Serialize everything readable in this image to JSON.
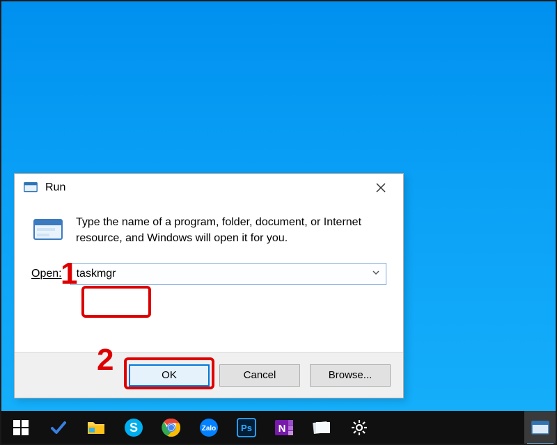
{
  "dialog": {
    "title": "Run",
    "instructions": "Type the name of a program, folder, document, or Internet resource, and Windows will open it for you.",
    "open_label": "Open:",
    "open_value": "taskmgr",
    "buttons": {
      "ok": "OK",
      "cancel": "Cancel",
      "browse": "Browse..."
    }
  },
  "annotations": {
    "label1": "1",
    "label2": "2"
  },
  "taskbar": {
    "start": "start-icon",
    "items": [
      "todo",
      "file-explorer",
      "skype",
      "chrome",
      "zalo",
      "photoshop",
      "onenote",
      "notes",
      "settings"
    ],
    "open_window": "run-window"
  }
}
